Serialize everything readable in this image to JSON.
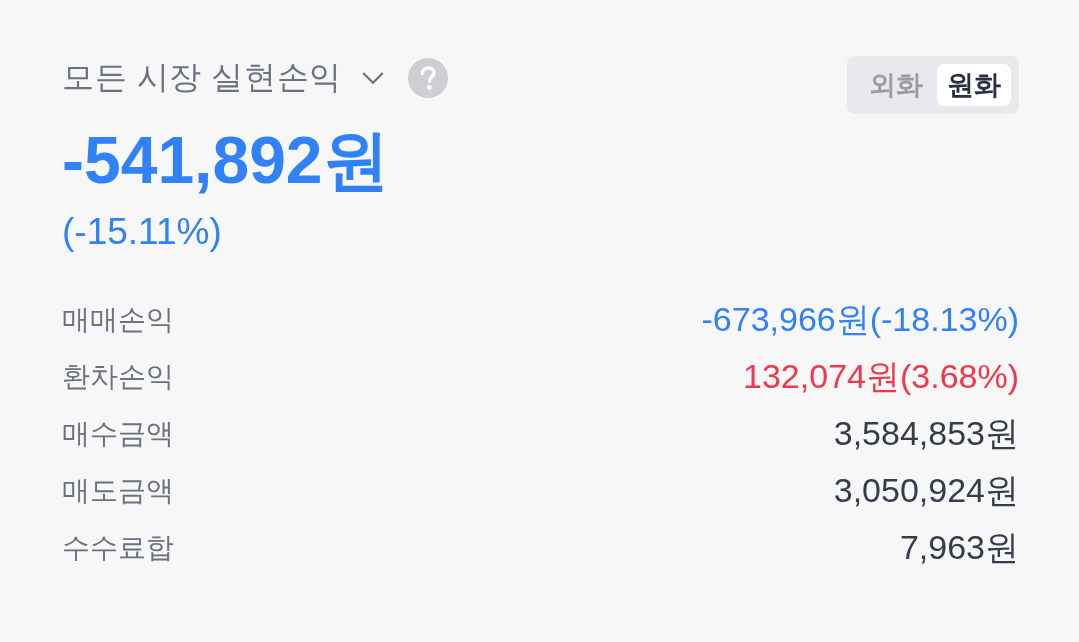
{
  "header": {
    "title": "모든 시장 실현손익",
    "currency_toggle": [
      {
        "label": "외화",
        "selected": false
      },
      {
        "label": "원화",
        "selected": true
      }
    ]
  },
  "summary": {
    "amount": "-541,892원",
    "percent": "(-15.11%)",
    "kind": "negative"
  },
  "rows": [
    {
      "label": "매매손익",
      "value": "-673,966원(-18.13%)",
      "kind": "negative"
    },
    {
      "label": "환차손익",
      "value": "132,074원(3.68%)",
      "kind": "positive"
    },
    {
      "label": "매수금액",
      "value": "3,584,853원",
      "kind": "plain"
    },
    {
      "label": "매도금액",
      "value": "3,050,924원",
      "kind": "plain"
    },
    {
      "label": "수수료합",
      "value": "7,963원",
      "kind": "plain"
    }
  ]
}
